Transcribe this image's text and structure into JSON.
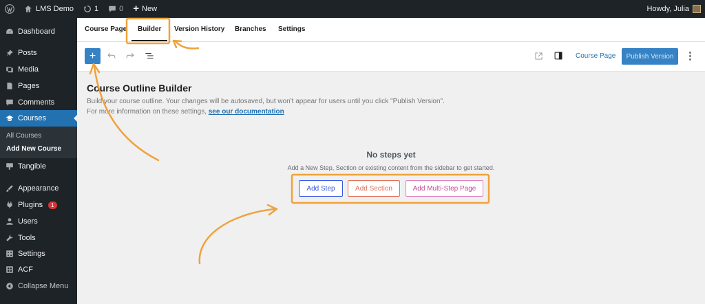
{
  "adminbar": {
    "site_name": "LMS Demo",
    "updates_count": "1",
    "comments_count": "0",
    "new_label": "New",
    "greeting": "Howdy, Julia"
  },
  "sidebar": {
    "items": [
      {
        "label": "Dashboard",
        "icon": "dashboard-icon"
      },
      {
        "label": "Posts",
        "icon": "pin-icon"
      },
      {
        "label": "Media",
        "icon": "media-icon"
      },
      {
        "label": "Pages",
        "icon": "page-icon"
      },
      {
        "label": "Comments",
        "icon": "comment-icon"
      },
      {
        "label": "Courses",
        "icon": "graduation-cap-icon"
      },
      {
        "label": "Tangible",
        "icon": "tangible-icon"
      },
      {
        "label": "Appearance",
        "icon": "brush-icon"
      },
      {
        "label": "Plugins",
        "icon": "plugin-icon",
        "badge": "1"
      },
      {
        "label": "Users",
        "icon": "user-icon"
      },
      {
        "label": "Tools",
        "icon": "wrench-icon"
      },
      {
        "label": "Settings",
        "icon": "settings-icon"
      },
      {
        "label": "ACF",
        "icon": "acf-icon"
      },
      {
        "label": "Collapse Menu",
        "icon": "collapse-icon"
      }
    ],
    "submenu": [
      "All Courses",
      "Add New Course"
    ]
  },
  "tabs": [
    "Course Page",
    "Builder",
    "Version History",
    "Branches",
    "Settings"
  ],
  "toolbar": {
    "course_page_link": "Course Page",
    "publish_label": "Publish Version",
    "add_label": "+"
  },
  "content": {
    "title": "Course Outline Builder",
    "desc_line1": "Build your course outline. Your changes will be autosaved, but won't appear for users until you click \"Publish Version\".",
    "desc_line2_prefix": "For more information on these settings, ",
    "doc_link": "see our documentation",
    "empty_title": "No steps yet",
    "empty_desc": "Add a New Step, Section or existing content from the sidebar to get started.",
    "buttons": {
      "step": "Add Step",
      "section": "Add Section",
      "multi": "Add Multi-Step Page"
    }
  },
  "colors": {
    "admin_dark": "#1d2327",
    "wp_blue": "#2271b1",
    "annotation_orange": "#f0a23b"
  }
}
